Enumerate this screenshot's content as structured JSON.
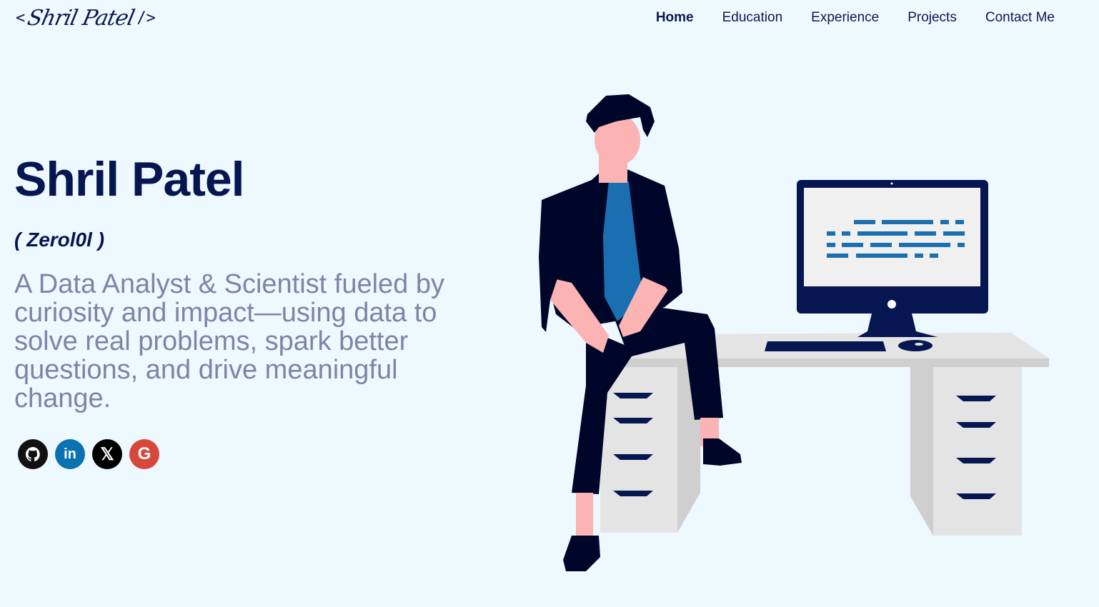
{
  "header": {
    "logo": {
      "open": "<",
      "name": "Shril Patel",
      "close": "/>"
    },
    "nav": [
      {
        "label": "Home",
        "active": true
      },
      {
        "label": "Education",
        "active": false
      },
      {
        "label": "Experience",
        "active": false
      },
      {
        "label": "Projects",
        "active": false
      },
      {
        "label": "Contact Me",
        "active": false
      }
    ]
  },
  "hero": {
    "name": "Shril Patel",
    "handle": "( Zerol0l )",
    "tagline": "A Data Analyst & Scientist fueled by curiosity and impact—using data to solve real problems, spark better questions, and drive meaningful change."
  },
  "socials": [
    {
      "icon": "github-icon",
      "glyph": "",
      "color": "#111111"
    },
    {
      "icon": "linkedin-icon",
      "glyph": "in",
      "color": "#0a72b1"
    },
    {
      "icon": "x-icon",
      "glyph": "𝕏",
      "color": "#000000"
    },
    {
      "icon": "google-icon",
      "glyph": "G",
      "color": "#d8473c"
    }
  ],
  "colors": {
    "background": "#eef8ff",
    "primary": "#051650",
    "muted": "#7b86a6",
    "accent": "#1a6fb0"
  }
}
